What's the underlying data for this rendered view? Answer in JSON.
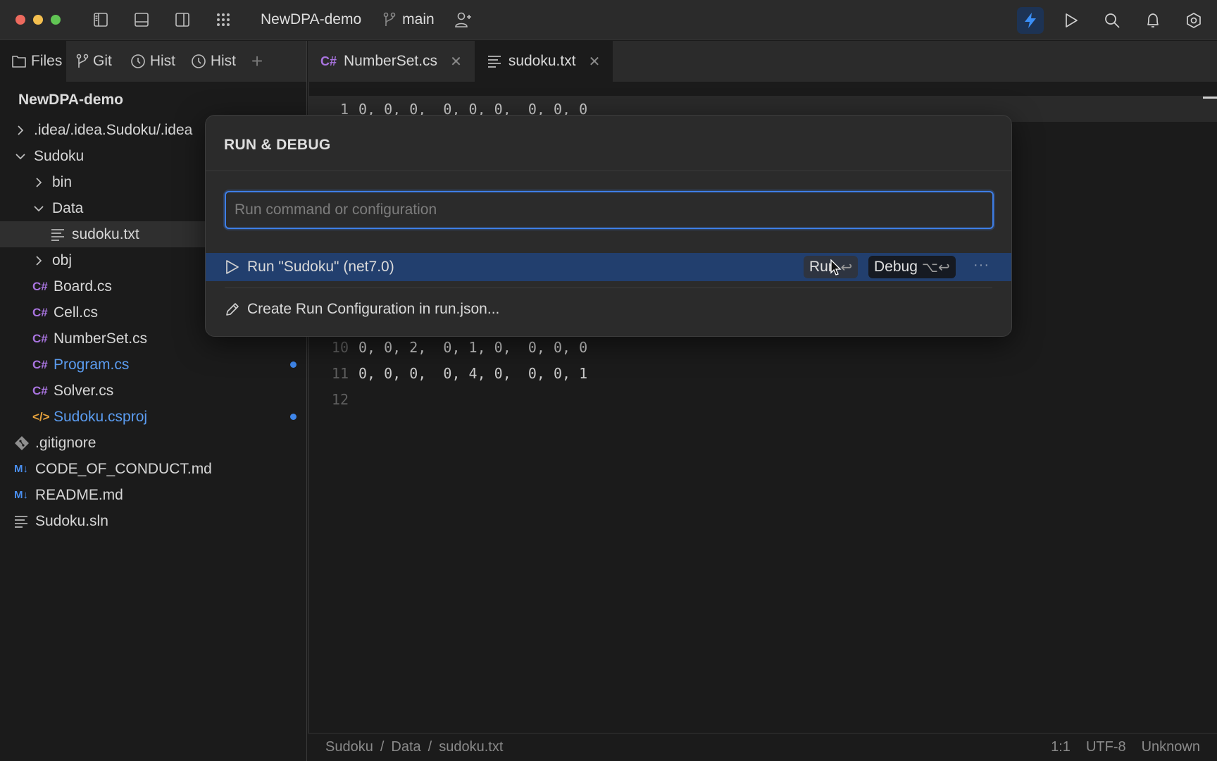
{
  "titlebar": {
    "project_name": "NewDPA-demo",
    "branch": "main",
    "traffic_colors": [
      "#ed6a5e",
      "#f4bf4f",
      "#61c554"
    ],
    "left_icons": [
      "sidebar-left-icon",
      "panel-bottom-icon",
      "sidebar-right-icon",
      "apps-grid-icon"
    ],
    "right_icons": [
      "lightning-icon",
      "run-icon",
      "search-icon",
      "bell-icon",
      "settings-icon"
    ],
    "accent": "#3a8ef6"
  },
  "side_tabs": [
    {
      "label": "Files",
      "icon": "folder-icon",
      "active": true
    },
    {
      "label": "Git",
      "icon": "git-branch-icon"
    },
    {
      "label": "Hist",
      "icon": "clock-icon"
    },
    {
      "label": "Hist",
      "icon": "clock-icon"
    }
  ],
  "editor_tabs": [
    {
      "label": "NumberSet.cs",
      "badge": "C#",
      "active": false
    },
    {
      "label": "sudoku.txt",
      "active": true
    }
  ],
  "sidebar": {
    "project_title": "NewDPA-demo",
    "items": [
      {
        "label": ".idea/.idea.Sudoku/.idea",
        "chevron": "›",
        "depth": 0
      },
      {
        "label": "Sudoku",
        "chevron": "⌄",
        "depth": 0
      },
      {
        "label": "bin",
        "chevron": "›",
        "depth": 1
      },
      {
        "label": "Data",
        "chevron": "⌄",
        "depth": 1
      },
      {
        "label": "sudoku.txt",
        "icon": "text-file-icon",
        "depth": 2,
        "selected": true
      },
      {
        "label": "obj",
        "chevron": "›",
        "depth": 1
      },
      {
        "label": "Board.cs",
        "icon": "C#",
        "depth": 1
      },
      {
        "label": "Cell.cs",
        "icon": "C#",
        "depth": 1
      },
      {
        "label": "NumberSet.cs",
        "icon": "C#",
        "depth": 1
      },
      {
        "label": "Program.cs",
        "icon": "C#",
        "depth": 1,
        "modified": true
      },
      {
        "label": "Solver.cs",
        "icon": "C#",
        "depth": 1
      },
      {
        "label": "Sudoku.csproj",
        "icon": "</>",
        "depth": 1,
        "modified": true
      },
      {
        "label": ".gitignore",
        "icon": "git-icon",
        "depth": 0
      },
      {
        "label": "CODE_OF_CONDUCT.md",
        "icon": "M↓",
        "depth": 0
      },
      {
        "label": "README.md",
        "icon": "M↓",
        "depth": 0
      },
      {
        "label": "Sudoku.sln",
        "icon": "text-file-icon",
        "depth": 0
      }
    ]
  },
  "editor": {
    "lines": [
      {
        "n": "1",
        "text": "0, 0, 0,  0, 0, 0,  0, 0, 0"
      },
      {
        "n": "10",
        "text": "0, 0, 2,  0, 1, 0,  0, 0, 0"
      },
      {
        "n": "11",
        "text": "0, 0, 0,  0, 4, 0,  0, 0, 1"
      },
      {
        "n": "12",
        "text": ""
      }
    ]
  },
  "popup": {
    "title": "RUN & DEBUG",
    "input_placeholder": "Run command or configuration",
    "input_value": "",
    "items": [
      {
        "label": "Run \"Sudoku\" (net7.0)",
        "icon": "play-icon",
        "highlighted": true
      },
      {
        "label": "Create Run Configuration in run.json...",
        "icon": "pencil-icon"
      }
    ],
    "run_button": {
      "label": "Run",
      "shortcut": "↩"
    },
    "debug_button": {
      "label": "Debug",
      "shortcut": "⌥↩"
    },
    "more_label": "···"
  },
  "statusbar": {
    "breadcrumb": [
      "Sudoku",
      "Data",
      "sudoku.txt"
    ],
    "separator": "/",
    "position": "1:1",
    "encoding": "UTF-8",
    "language": "Unknown"
  }
}
